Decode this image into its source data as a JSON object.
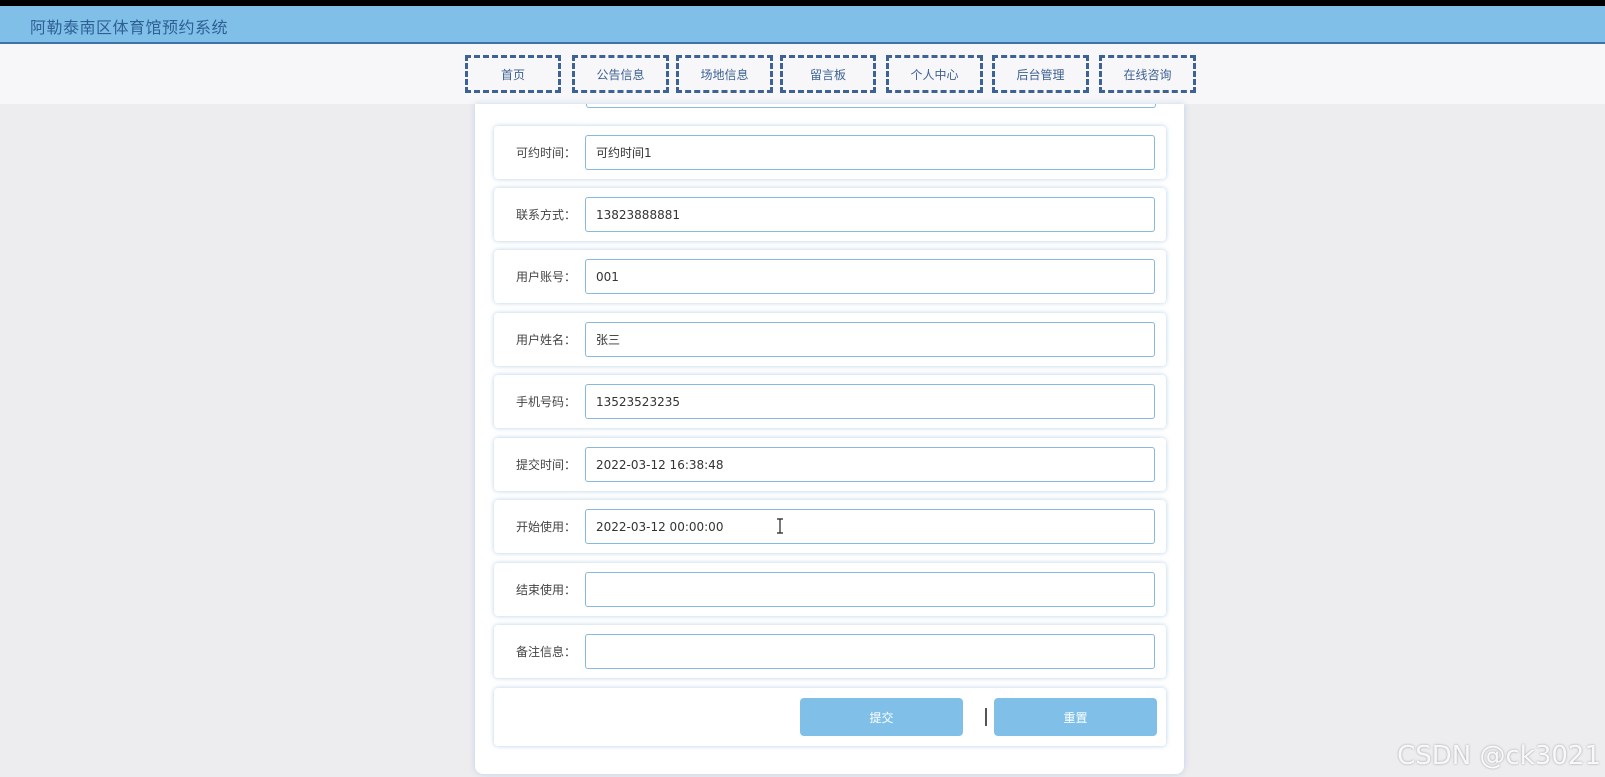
{
  "header": {
    "title": "阿勒泰南区体育馆预约系统"
  },
  "nav": {
    "items": [
      {
        "label": "首页"
      },
      {
        "label": "公告信息"
      },
      {
        "label": "场地信息"
      },
      {
        "label": "留言板"
      },
      {
        "label": "个人中心"
      },
      {
        "label": "后台管理"
      },
      {
        "label": "在线咨询"
      }
    ]
  },
  "form": {
    "fields": [
      {
        "label": "可约时间：",
        "value": "可约时间1"
      },
      {
        "label": "联系方式：",
        "value": "13823888881"
      },
      {
        "label": "用户账号：",
        "value": "001"
      },
      {
        "label": "用户姓名：",
        "value": "张三"
      },
      {
        "label": "手机号码：",
        "value": "13523523235"
      },
      {
        "label": "提交时间：",
        "value": "2022-03-12 16:38:48"
      },
      {
        "label": "开始使用：",
        "value": "2022-03-12 00:00:00"
      },
      {
        "label": "结束使用：",
        "value": ""
      },
      {
        "label": "备注信息：",
        "value": ""
      }
    ],
    "submit_label": "提交",
    "reset_label": "重置"
  },
  "colors": {
    "accent": "#80c0e8",
    "nav_text": "#3d6295",
    "title_text": "#2e5f95"
  },
  "watermark": "CSDN @ck3021"
}
